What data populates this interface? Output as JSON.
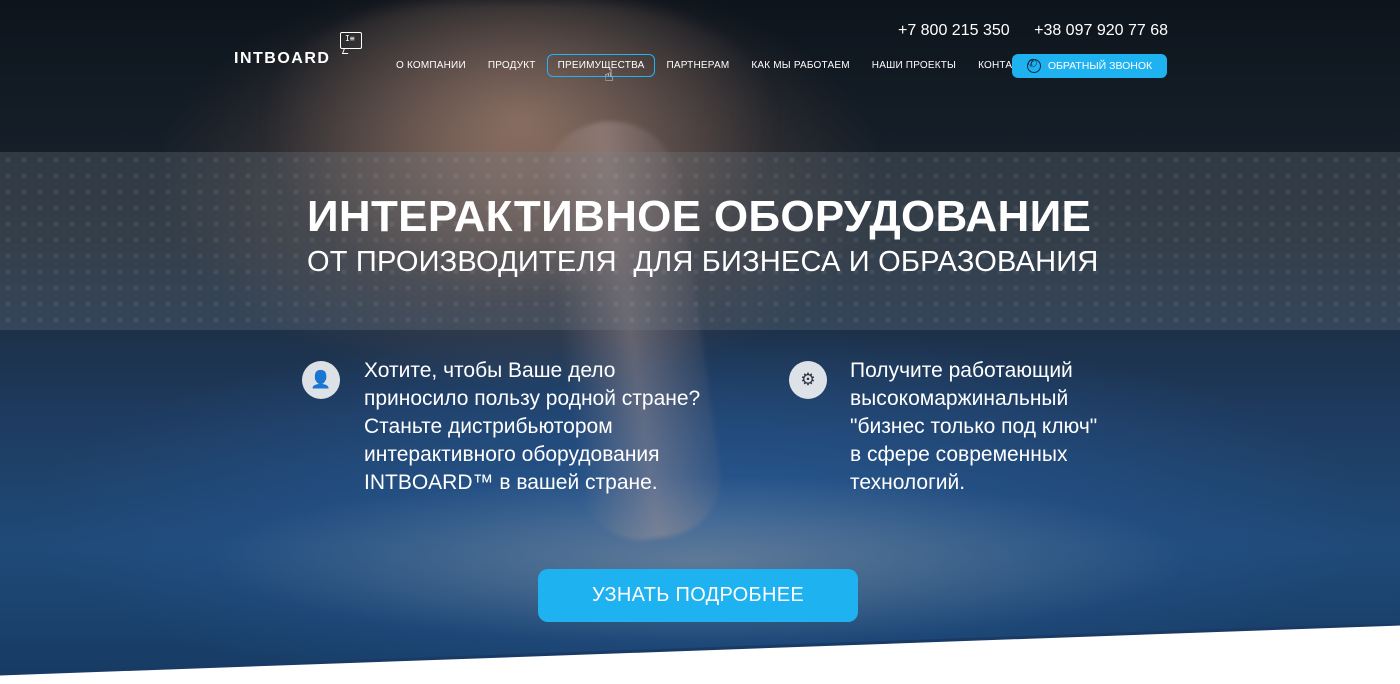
{
  "header": {
    "logo_text": "INTBOARD",
    "logo_icon_text": "I≡",
    "phones": [
      "+7 800 215 350",
      "+38 097 920 77 68"
    ],
    "nav": [
      {
        "label": "О КОМПАНИИ"
      },
      {
        "label": "ПРОДУКТ"
      },
      {
        "label": "ПРЕИМУЩЕСТВА"
      },
      {
        "label": "ПАРТНЕРАМ"
      },
      {
        "label": "КАК МЫ РАБОТАЕМ"
      },
      {
        "label": "НАШИ ПРОЕКТЫ"
      },
      {
        "label": "КОНТАКТЫ"
      }
    ],
    "callback_label": "ОБРАТНЫЙ ЗВОНОК"
  },
  "hero": {
    "title": "ИНТЕРАКТИВНОЕ ОБОРУДОВАНИЕ",
    "subtitle": "ОТ ПРОИЗВОДИТЕЛЯ  ДЛЯ БИЗНЕСА И ОБРАЗОВАНИЯ",
    "features": [
      {
        "icon": "handshake-user-icon",
        "lines": [
          "Хотите, чтобы Ваше дело",
          "приносило пользу родной стране?",
          "Станьте дистрибьютором",
          "интерактивного оборудования",
          "INTBOARD™ в вашей стране."
        ]
      },
      {
        "icon": "hand-gear-icon",
        "lines": [
          "Получите работающий",
          "высокомаржинальный",
          "\"бизнес только под ключ\"",
          "в сфере современных",
          "технологий."
        ]
      }
    ],
    "cta_label": "УЗНАТЬ ПОДРОБНЕЕ"
  },
  "colors": {
    "accent": "#1fb2f1",
    "active_border": "#22b4f2"
  }
}
